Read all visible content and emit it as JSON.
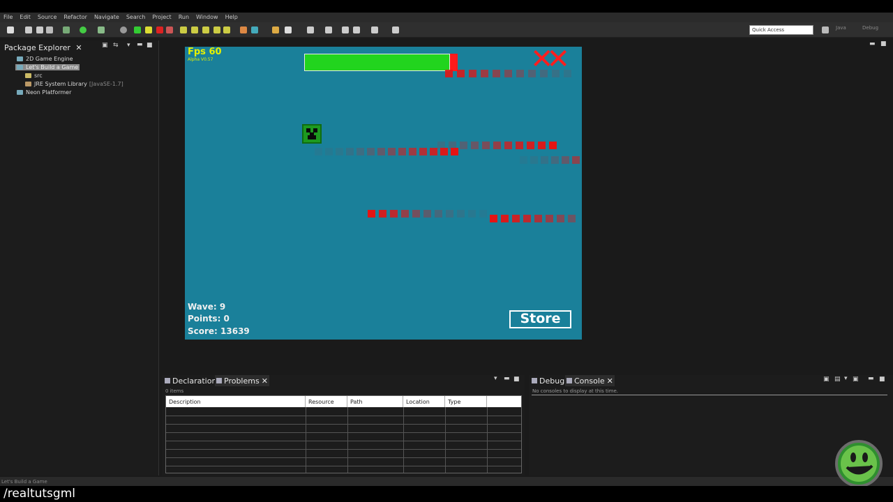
{
  "menu": [
    "File",
    "Edit",
    "Source",
    "Refactor",
    "Navigate",
    "Search",
    "Project",
    "Run",
    "Window",
    "Help"
  ],
  "quick_access": {
    "placeholder": "Quick Access"
  },
  "perspectives": [
    "Java",
    "Debug"
  ],
  "package_explorer": {
    "title": "Package Explorer",
    "items": [
      {
        "label": "2D Game Engine"
      },
      {
        "label": "Let's Build a Game"
      },
      {
        "label": "src"
      },
      {
        "label": "JRE System Library",
        "extra": "[JavaSE-1.7]"
      },
      {
        "label": "Neon Platformer"
      }
    ]
  },
  "game": {
    "fps_label": "Fps 60",
    "version": "Alpha V0.57",
    "health_fraction": 0.95,
    "wave": "Wave: 9",
    "points": "Points: 0",
    "score": "Score: 13639",
    "store_label": "Store"
  },
  "problems_panel": {
    "tabs": [
      "Declaration",
      "Problems"
    ],
    "count": "0 items",
    "columns": [
      "Description",
      "Resource",
      "Path",
      "Location",
      "Type"
    ]
  },
  "console_panel": {
    "tabs": [
      "Debug",
      "Console"
    ],
    "message": "No consoles to display at this time."
  },
  "status_text": "Let's Build a Game",
  "watermark": "/realtutsgml",
  "colors": {
    "game_bg": "#1a809a",
    "health": "#22d41e",
    "enemy": "#e41414",
    "fps": "#e6f000"
  }
}
